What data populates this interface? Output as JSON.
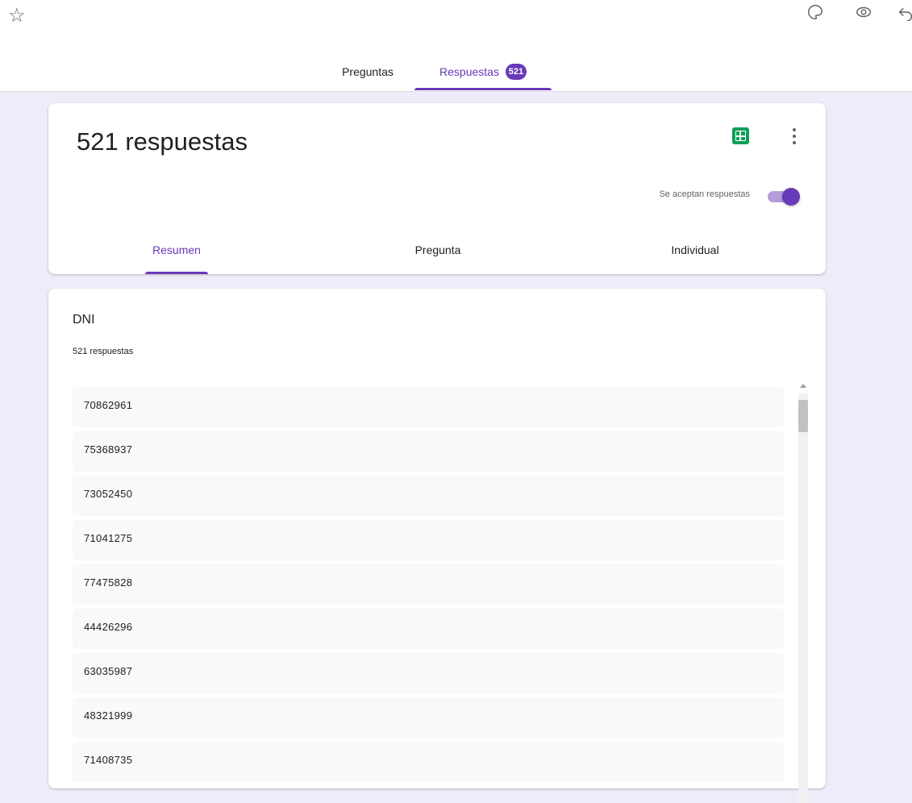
{
  "toolbar": {
    "icons": [
      "star-icon",
      "palette-icon",
      "preview-eye-icon",
      "undo-icon"
    ]
  },
  "main_tabs": [
    {
      "label": "Preguntas",
      "active": false
    },
    {
      "label": "Respuestas",
      "active": true,
      "badge": "521"
    }
  ],
  "summary": {
    "title": "521 respuestas",
    "accepting_label": "Se aceptan respuestas",
    "accepting_on": true
  },
  "sub_tabs": [
    {
      "label": "Resumen",
      "active": true
    },
    {
      "label": "Pregunta",
      "active": false
    },
    {
      "label": "Individual",
      "active": false
    }
  ],
  "question": {
    "title": "DNI",
    "count_label": "521 respuestas",
    "responses": [
      "70862961",
      "75368937",
      "73052450",
      "71041275",
      "77475828",
      "44426296",
      "63035987",
      "48321999",
      "71408735"
    ]
  },
  "colors": {
    "accent": "#673ab7",
    "background": "#f0ebf8",
    "sheets_green": "#0f9d58"
  }
}
